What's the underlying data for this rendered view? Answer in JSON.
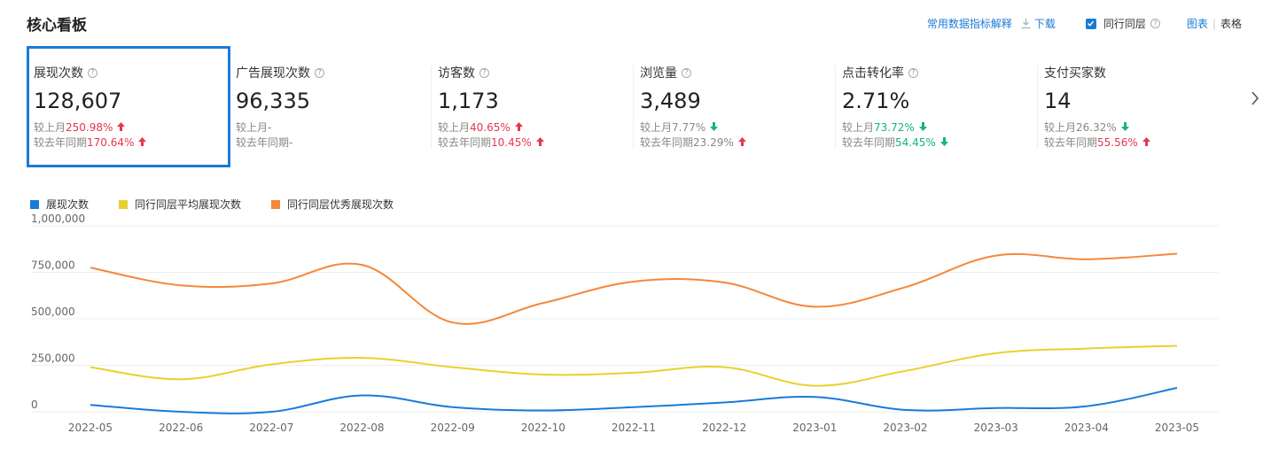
{
  "page": {
    "title": "核心看板"
  },
  "actions": {
    "explain_label": "常用数据指标解释",
    "download_label": "下载",
    "peer_label": "同行同层",
    "view_chart": "图表",
    "view_table": "表格"
  },
  "metrics": [
    {
      "name": "展现次数",
      "value": "128,607",
      "cmp1_label": "较上月",
      "cmp1_value": "250.98%",
      "cmp1_dir": "up",
      "cmp2_label": "较去年同期",
      "cmp2_value": "170.64%",
      "cmp2_dir": "up"
    },
    {
      "name": "广告展现次数",
      "value": "96,335",
      "cmp1_label": "较上月",
      "cmp1_value": "-",
      "cmp1_dir": "none",
      "cmp2_label": "较去年同期",
      "cmp2_value": "-",
      "cmp2_dir": "none"
    },
    {
      "name": "访客数",
      "value": "1,173",
      "cmp1_label": "较上月",
      "cmp1_value": "40.65%",
      "cmp1_dir": "up",
      "cmp2_label": "较去年同期",
      "cmp2_value": "10.45%",
      "cmp2_dir": "up"
    },
    {
      "name": "浏览量",
      "value": "3,489",
      "cmp1_label": "较上月",
      "cmp1_value": "7.77%",
      "cmp1_dir": "down",
      "cmp2_label": "较去年同期",
      "cmp2_value": "23.29%",
      "cmp2_dir": "up"
    },
    {
      "name": "点击转化率",
      "value": "2.71%",
      "cmp1_label": "较上月",
      "cmp1_value": "73.72%",
      "cmp1_dir": "down",
      "cmp2_label": "较去年同期",
      "cmp2_value": "54.45%",
      "cmp2_dir": "down"
    },
    {
      "name": "支付买家数",
      "value": "14",
      "cmp1_label": "较上月",
      "cmp1_value": "26.32%",
      "cmp1_dir": "down",
      "cmp2_label": "较去年同期",
      "cmp2_value": "55.56%",
      "cmp2_dir": "up"
    }
  ],
  "colors": {
    "accent": "#1a7bd6",
    "up": "#e8364b",
    "down": "#14b37e"
  },
  "chart_data": {
    "type": "line",
    "x": [
      "2022-05",
      "2022-06",
      "2022-07",
      "2022-08",
      "2022-09",
      "2022-10",
      "2022-11",
      "2022-12",
      "2023-01",
      "2023-02",
      "2023-03",
      "2023-04",
      "2023-05"
    ],
    "series": [
      {
        "name": "展现次数",
        "color": "#1a7bd6",
        "values": [
          37000,
          0,
          0,
          88000,
          25000,
          7000,
          25000,
          50000,
          80000,
          10000,
          20000,
          30000,
          128607
        ]
      },
      {
        "name": "同行同层平均展现次数",
        "color": "#e8d12e",
        "values": [
          240000,
          175000,
          255000,
          290000,
          240000,
          200000,
          210000,
          240000,
          140000,
          220000,
          315000,
          340000,
          355000
        ]
      },
      {
        "name": "同行同层优秀展现次数",
        "color": "#f5873a",
        "values": [
          775000,
          680000,
          690000,
          790000,
          480000,
          585000,
          700000,
          695000,
          565000,
          670000,
          840000,
          820000,
          850000
        ]
      }
    ],
    "yticks": [
      "1,000,000",
      "750,000",
      "500,000",
      "250,000",
      "0"
    ],
    "ylim": [
      0,
      1000000
    ]
  }
}
